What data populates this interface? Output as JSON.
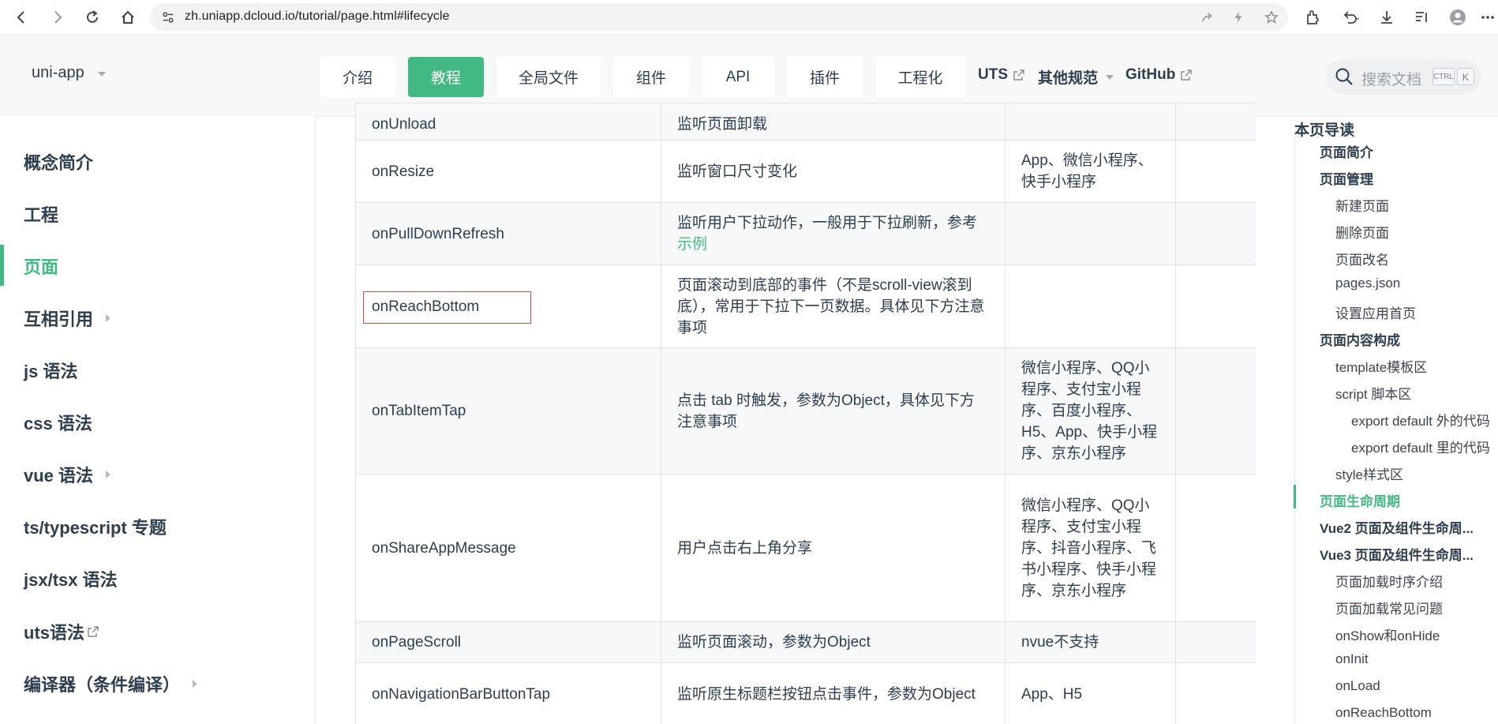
{
  "browser": {
    "url": "zh.uniapp.dcloud.io/tutorial/page.html#lifecycle",
    "icons": [
      "back-icon",
      "forward-icon",
      "reload-icon",
      "home-icon",
      "site-info-icon",
      "share-icon",
      "extension-bolt-icon",
      "bookmark-star-icon",
      "extensions-icon",
      "undo-icon",
      "download-icon",
      "reading-list-icon",
      "profile-icon",
      "menu-icon"
    ]
  },
  "header": {
    "brand": "uni-app",
    "nav": [
      {
        "label": "介绍"
      },
      {
        "label": "教程"
      },
      {
        "label": "全局文件"
      },
      {
        "label": "组件"
      },
      {
        "label": "API"
      },
      {
        "label": "插件"
      },
      {
        "label": "工程化"
      }
    ],
    "links": {
      "uts": "UTS",
      "other": "其他规范",
      "github": "GitHub"
    },
    "search": {
      "placeholder": "搜索文档",
      "key_ctrl": "CTRL",
      "key_k": "K"
    },
    "accent_color": "#42b983"
  },
  "sidebar": {
    "items": [
      {
        "label": "概念简介"
      },
      {
        "label": "工程"
      },
      {
        "label": "页面"
      },
      {
        "label": "互相引用"
      },
      {
        "label": "js 语法"
      },
      {
        "label": "css 语法"
      },
      {
        "label": "vue 语法"
      },
      {
        "label": "ts/typescript 专题"
      },
      {
        "label": "jsx/tsx 语法"
      },
      {
        "label": "uts语法"
      },
      {
        "label": "编译器（条件编译）"
      }
    ]
  },
  "table": {
    "rows": [
      {
        "name": "onUnload",
        "desc": "监听页面卸载",
        "platform": ""
      },
      {
        "name": "onResize",
        "desc": "监听窗口尺寸变化",
        "platform": "App、微信小程序、快手小程序"
      },
      {
        "name": "onPullDownRefresh",
        "desc": "监听用户下拉动作，一般用于下拉刷新，参考",
        "desc_link": "示例",
        "platform": ""
      },
      {
        "name": "onReachBottom",
        "desc": "页面滚动到底部的事件（不是scroll-view滚到底），常用于下拉下一页数据。具体见下方注意事项",
        "platform": ""
      },
      {
        "name": "onTabItemTap",
        "desc": "点击 tab 时触发，参数为Object，具体见下方注意事项",
        "platform": "微信小程序、QQ小程序、支付宝小程序、百度小程序、H5、App、快手小程序、京东小程序"
      },
      {
        "name": "onShareAppMessage",
        "desc": "用户点击右上角分享",
        "platform": "微信小程序、QQ小程序、支付宝小程序、抖音小程序、飞书小程序、快手小程序、京东小程序"
      },
      {
        "name": "onPageScroll",
        "desc": "监听页面滚动，参数为Object",
        "platform": "nvue不支持"
      },
      {
        "name": "onNavigationBarButtonTap",
        "desc": "监听原生标题栏按钮点击事件，参数为Object",
        "platform": "App、H5"
      }
    ]
  },
  "toc": {
    "title": "本页导读",
    "items": [
      {
        "label": "页面简介"
      },
      {
        "label": "页面管理"
      },
      {
        "label": "新建页面"
      },
      {
        "label": "删除页面"
      },
      {
        "label": "页面改名"
      },
      {
        "label": "pages.json"
      },
      {
        "label": "设置应用首页"
      },
      {
        "label": "页面内容构成"
      },
      {
        "label": "template模板区"
      },
      {
        "label": "script 脚本区"
      },
      {
        "label": "export default 外的代码"
      },
      {
        "label": "export default 里的代码"
      },
      {
        "label": "style样式区"
      },
      {
        "label": "页面生命周期"
      },
      {
        "label": "Vue2 页面及组件生命周..."
      },
      {
        "label": "Vue3 页面及组件生命周..."
      },
      {
        "label": "页面加载时序介绍"
      },
      {
        "label": "页面加载常见问题"
      },
      {
        "label": "onShow和onHide"
      },
      {
        "label": "onInit"
      },
      {
        "label": "onLoad"
      },
      {
        "label": "onReachBottom"
      }
    ]
  }
}
